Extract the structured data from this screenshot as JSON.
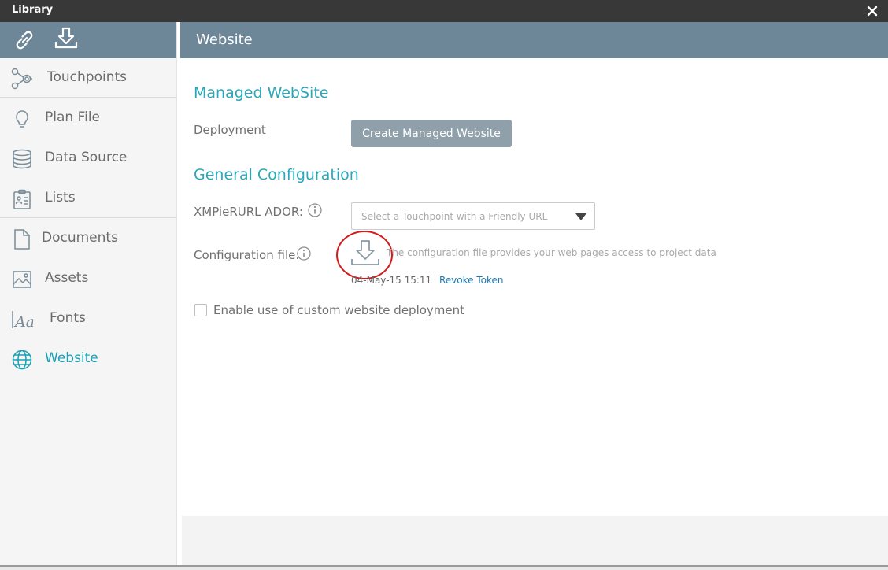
{
  "window": {
    "title": "Library"
  },
  "colors": {
    "accent": "#1aa0b3",
    "header_bg": "#6e8798",
    "title_bar": "#383838",
    "button_bg": "#8fa0aa",
    "link": "#1a7bb5",
    "highlight_circle": "#d21b1b"
  },
  "sidebar": {
    "top_icons": [
      "link-icon",
      "download-icon"
    ],
    "items": [
      {
        "label": "Touchpoints",
        "icon": "touchpoints-icon",
        "active": false
      },
      {
        "label": "Plan File",
        "icon": "lightbulb-icon",
        "active": false
      },
      {
        "label": "Data Source",
        "icon": "database-icon",
        "active": false
      },
      {
        "label": "Lists",
        "icon": "clipboard-list-icon",
        "active": false
      },
      {
        "label": "Documents",
        "icon": "document-icon",
        "active": false
      },
      {
        "label": "Assets",
        "icon": "image-icon",
        "active": false
      },
      {
        "label": "Fonts",
        "icon": "fonts-icon",
        "active": false
      },
      {
        "label": "Website",
        "icon": "globe-icon",
        "active": true
      }
    ]
  },
  "header": {
    "title": "Website"
  },
  "main": {
    "managed_section": {
      "title": "Managed WebSite",
      "deployment_label": "Deployment",
      "create_button": "Create Managed Website"
    },
    "general_section": {
      "title": "General Configuration",
      "xmpie_label": "XMPieRURL ADOR:",
      "select_placeholder": "Select a Touchpoint with a Friendly URL",
      "config_label": "Configuration file:",
      "config_description": "The configuration file provides your web pages access to project data",
      "token_date": "04-May-15 15:11",
      "revoke_link": "Revoke Token"
    },
    "custom_deployment": {
      "label": "Enable use of custom website deployment",
      "checked": false
    }
  }
}
